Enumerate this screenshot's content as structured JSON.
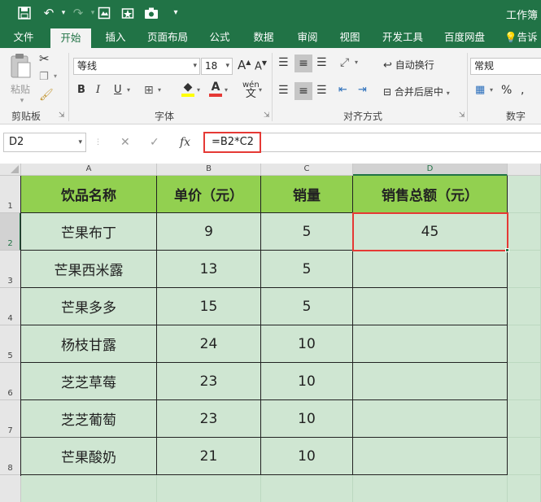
{
  "titlebar": {
    "title": "工作簿",
    "qat": [
      "save-icon",
      "undo-icon",
      "redo-icon",
      "screenshot-icon",
      "form-icon",
      "camera-icon",
      "qat-dropdown-icon"
    ],
    "bg_color": "#217346"
  },
  "tabs": [
    "文件",
    "开始",
    "插入",
    "页面布局",
    "公式",
    "数据",
    "审阅",
    "视图",
    "开发工具",
    "百度网盘",
    "告诉"
  ],
  "active_tab": "开始",
  "ribbon": {
    "clipboard": {
      "paste_label": "粘贴",
      "group_label": "剪贴板"
    },
    "font": {
      "font_name": "等线",
      "font_size": "18",
      "grow_label": "A",
      "shrink_label": "A",
      "bold_label": "B",
      "italic_label": "I",
      "underline_label": "U",
      "font_color_label": "A",
      "phonetic_label": "wén",
      "group_label": "字体"
    },
    "alignment": {
      "wrap_text_label": "自动换行",
      "merge_center_label": "合并后居中",
      "group_label": "对齐方式"
    },
    "number": {
      "format": "常规",
      "percent_label": "%",
      "group_label": "数字"
    }
  },
  "formula_bar": {
    "name_box": "D2",
    "cancel_label": "✕",
    "enter_label": "✓",
    "fx_label": "fx",
    "formula": "=B2*C2"
  },
  "sheet": {
    "columns": [
      "A",
      "B",
      "C",
      "D"
    ],
    "rows": [
      "1",
      "2",
      "3",
      "4",
      "5",
      "6",
      "7",
      "8"
    ],
    "selected_cell": "D2",
    "header_fill": "#92d050",
    "cell_fill": "#cfe6d2",
    "headers": [
      "饮品名称",
      "单价（元）",
      "销量",
      "销售总额（元）"
    ],
    "data": [
      [
        "芒果布丁",
        "9",
        "5",
        "45"
      ],
      [
        "芒果西米露",
        "13",
        "5",
        ""
      ],
      [
        "芒果多多",
        "15",
        "5",
        ""
      ],
      [
        "杨枝甘露",
        "24",
        "10",
        ""
      ],
      [
        "芝芝草莓",
        "23",
        "10",
        ""
      ],
      [
        "芝芝葡萄",
        "23",
        "10",
        ""
      ],
      [
        "芒果酸奶",
        "21",
        "10",
        ""
      ]
    ]
  }
}
